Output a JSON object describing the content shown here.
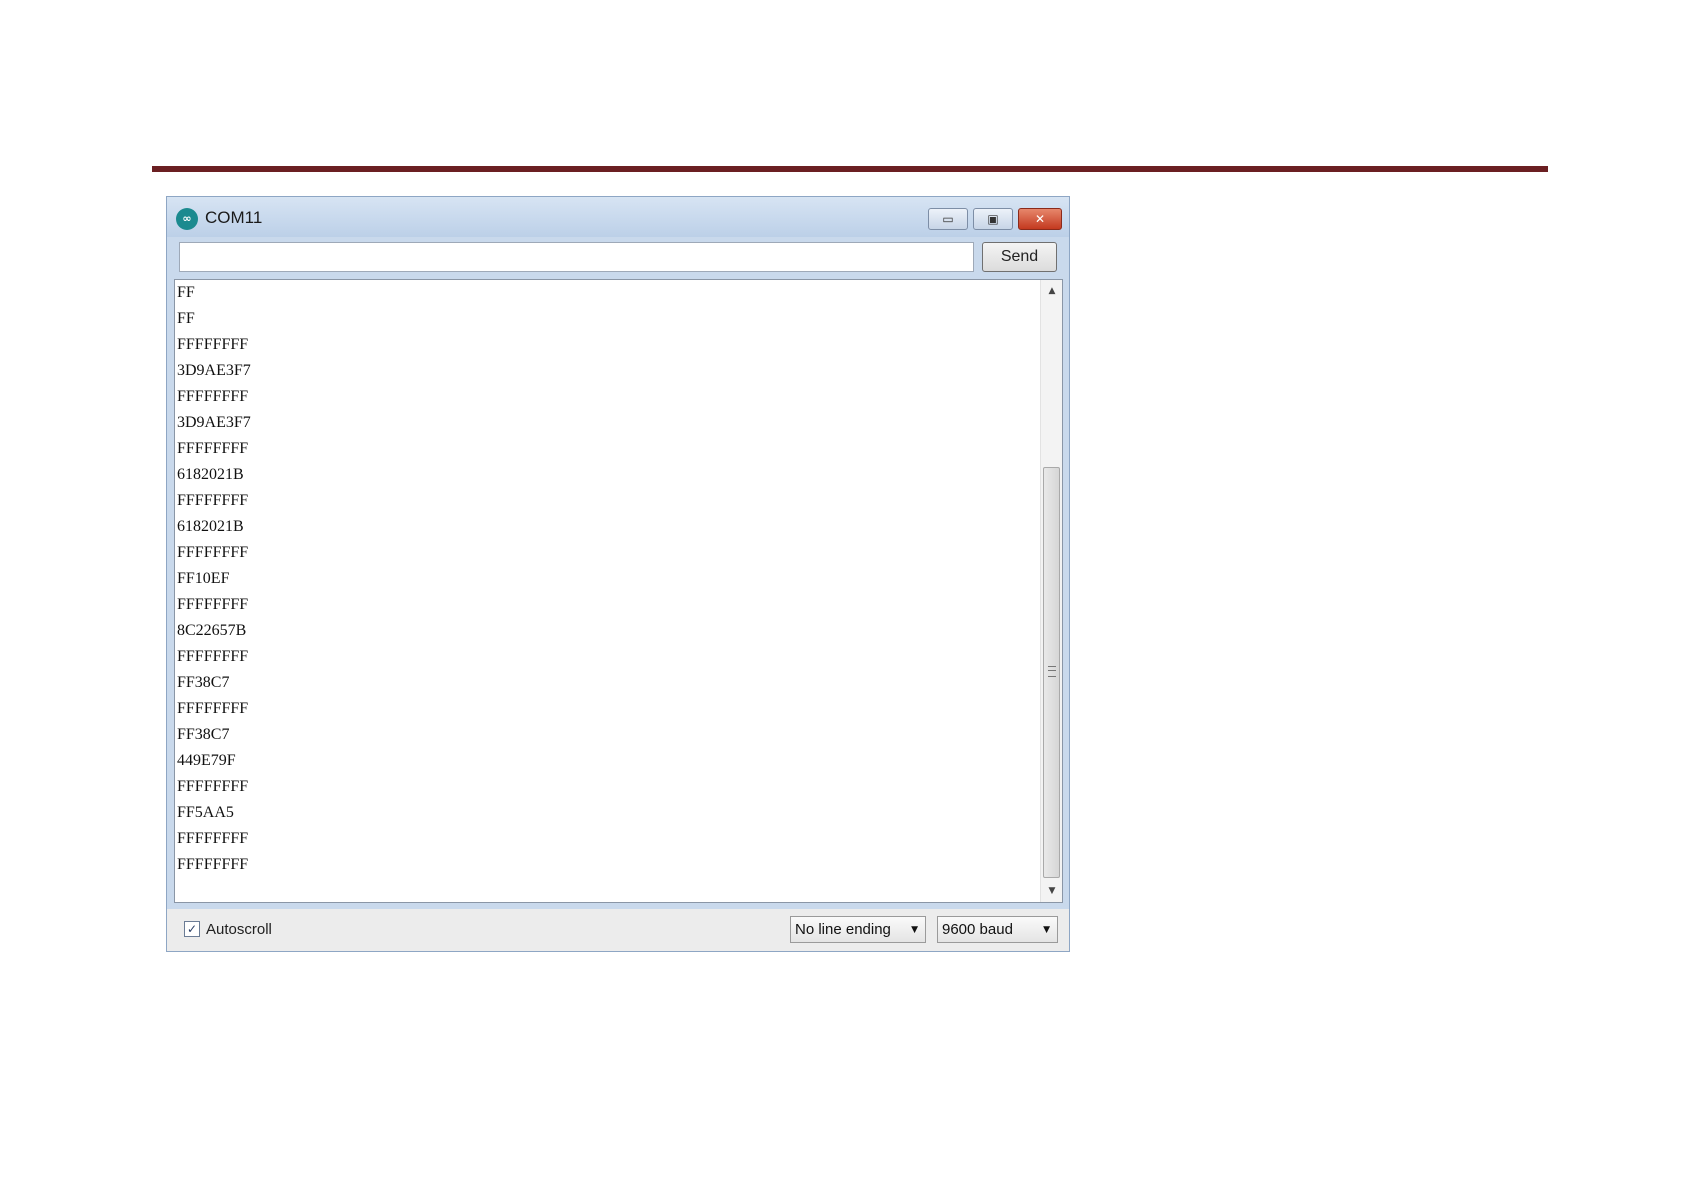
{
  "window": {
    "title": "COM11",
    "app_icon_glyph": "∞",
    "controls": {
      "minimize": "▭",
      "maximize": "▣",
      "close": "✕"
    }
  },
  "send": {
    "input_value": "",
    "input_placeholder": "",
    "button_label": "Send"
  },
  "output_lines": [
    "FF",
    "FF",
    "FFFFFFFF",
    "3D9AE3F7",
    "FFFFFFFF",
    "3D9AE3F7",
    "FFFFFFFF",
    "6182021B",
    "FFFFFFFF",
    "6182021B",
    "FFFFFFFF",
    "FF10EF",
    "FFFFFFFF",
    "8C22657B",
    "FFFFFFFF",
    "FF38C7",
    "FFFFFFFF",
    "FF38C7",
    "449E79F",
    "FFFFFFFF",
    "FF5AA5",
    "FFFFFFFF",
    "FFFFFFFF"
  ],
  "scrollbar": {
    "up_arrow": "▲",
    "down_arrow": "▼"
  },
  "footer": {
    "autoscroll_label": "Autoscroll",
    "autoscroll_mark": "✓",
    "line_ending": "No line ending",
    "baud_rate": "9600 baud",
    "caret": "▼"
  },
  "colors": {
    "header_rule": "#6b1f22",
    "close_button": "#c3391f"
  }
}
